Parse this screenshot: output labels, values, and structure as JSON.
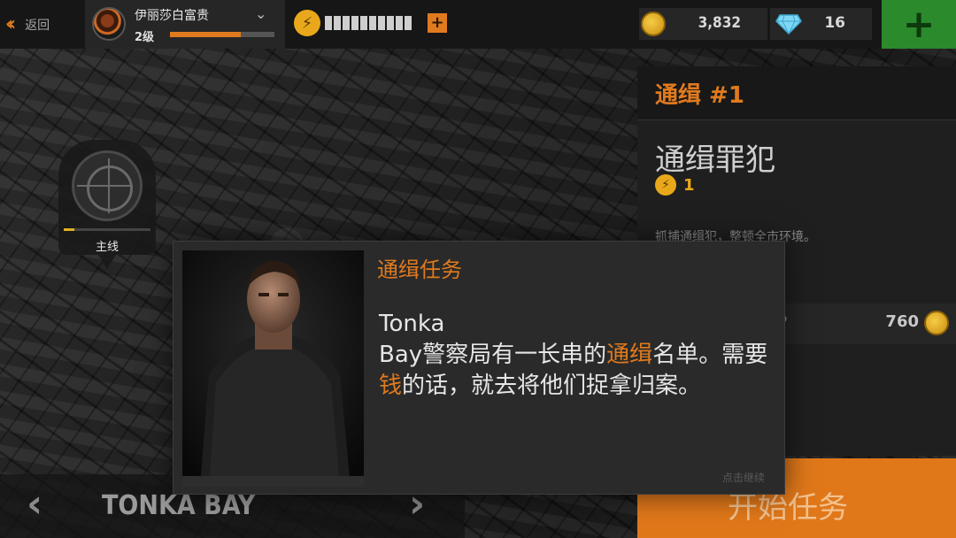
{
  "topbar": {
    "back_label": "返回",
    "player_name": "伊丽莎白富贵",
    "player_level": "2级",
    "xp_progress": 0.68,
    "energy_segments": 10,
    "coins": "3,832",
    "gems": "16"
  },
  "map": {
    "marker_label": "主线",
    "marker_progress": 0.12,
    "region_name": "TONKA BAY"
  },
  "mission_panel": {
    "header": "通缉 #1",
    "title": "通缉罪犯",
    "energy_cost": "1",
    "description": "抓捕通缉犯，整顿全市环境。",
    "reward_xp_label": "P",
    "reward_coins": "760",
    "start_button": "开始任务"
  },
  "dialog": {
    "title": "通缉任务",
    "body_part1": "Tonka",
    "body_part2": "Bay警察局有一长串的",
    "body_highlight1": "通缉",
    "body_part3": "名单。需要",
    "body_highlight2": "钱",
    "body_part4": "的话，就去将他们捉拿归案。",
    "continue_hint": "点击继续"
  },
  "colors": {
    "accent": "#e07a1e",
    "add_button": "#2b8a2b",
    "coin": "#e9a81b"
  }
}
